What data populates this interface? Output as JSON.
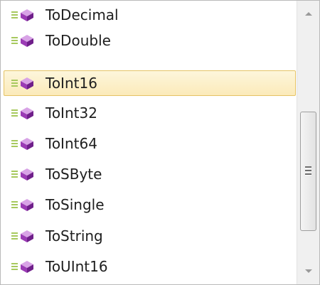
{
  "completion_list": {
    "item_icon": "extension-method-icon",
    "selected_index": 2,
    "items": [
      {
        "label": "ToDecimal"
      },
      {
        "label": "ToDouble"
      },
      {
        "label": "ToInt16"
      },
      {
        "label": "ToInt32"
      },
      {
        "label": "ToInt64"
      },
      {
        "label": "ToSByte"
      },
      {
        "label": "ToSingle"
      },
      {
        "label": "ToString"
      },
      {
        "label": "ToUInt16"
      }
    ]
  },
  "scrollbar": {
    "up_icon": "arrow-up-icon",
    "down_icon": "arrow-down-icon",
    "grip_icon": "grip-icon"
  },
  "colors": {
    "selection_fill": "#fbeaba",
    "selection_border": "#e5c365",
    "icon_purple": "#9b3bb5",
    "icon_lines": "#8fb23f"
  }
}
